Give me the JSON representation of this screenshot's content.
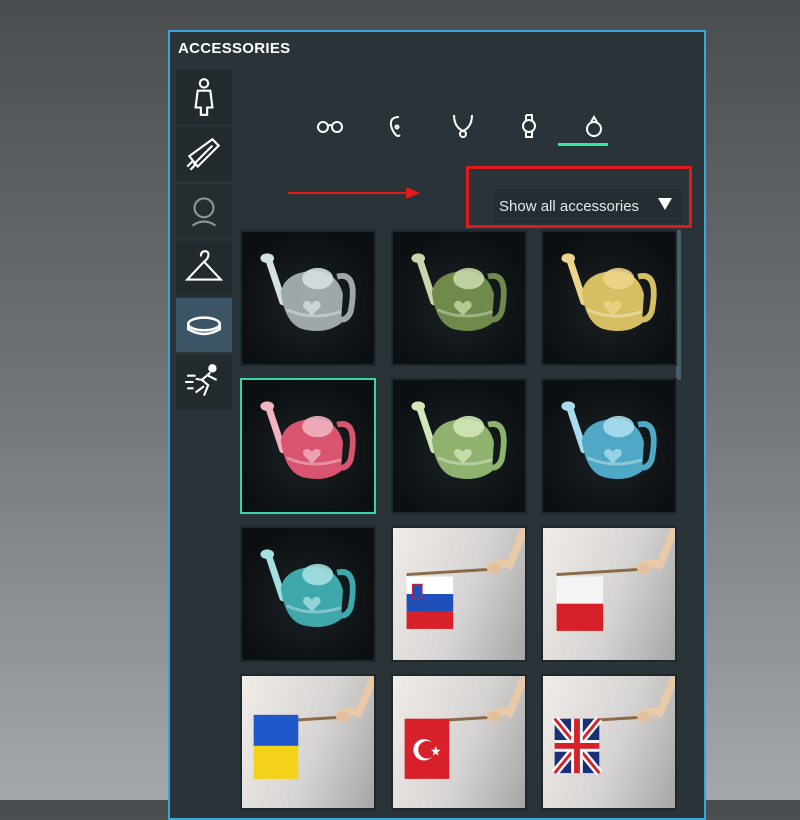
{
  "panel": {
    "title": "ACCESSORIES"
  },
  "sidebar": {
    "items": [
      {
        "icon": "person-icon",
        "active": false
      },
      {
        "icon": "comb-icon",
        "active": false
      },
      {
        "icon": "head-icon",
        "active": false
      },
      {
        "icon": "hanger-icon",
        "active": false
      },
      {
        "icon": "ring-icon",
        "active": true
      },
      {
        "icon": "running-icon",
        "active": false
      }
    ]
  },
  "tabs": {
    "items": [
      {
        "icon": "glasses-icon"
      },
      {
        "icon": "earring-icon"
      },
      {
        "icon": "necklace-icon"
      },
      {
        "icon": "watch-icon"
      },
      {
        "icon": "ring-icon",
        "active": true
      }
    ],
    "accent_color": "#2ee8a0"
  },
  "filter": {
    "selected": "Show all accessories"
  },
  "annotation": {
    "color": "#e01a1a"
  },
  "grid": {
    "items": [
      {
        "type": "watering-can",
        "color": "#9fa7a8",
        "accent": "#d6e0e0"
      },
      {
        "type": "watering-can",
        "color": "#6f8a4a",
        "accent": "#c9d6a9"
      },
      {
        "type": "watering-can",
        "color": "#d6bf62",
        "accent": "#edd48a"
      },
      {
        "type": "watering-can",
        "color": "#d9546f",
        "accent": "#f0b3c0",
        "selected": true
      },
      {
        "type": "watering-can",
        "color": "#8fb36e",
        "accent": "#d2e6b8"
      },
      {
        "type": "watering-can",
        "color": "#4fa9c6",
        "accent": "#a8dcec"
      },
      {
        "type": "watering-can",
        "color": "#3fa8ad",
        "accent": "#a5dfe0"
      },
      {
        "type": "flag",
        "country": "Slovenia"
      },
      {
        "type": "flag",
        "country": "Poland"
      },
      {
        "type": "flag",
        "country": "Ukraine"
      },
      {
        "type": "flag",
        "country": "Turkey"
      },
      {
        "type": "flag",
        "country": "United Kingdom"
      }
    ]
  }
}
